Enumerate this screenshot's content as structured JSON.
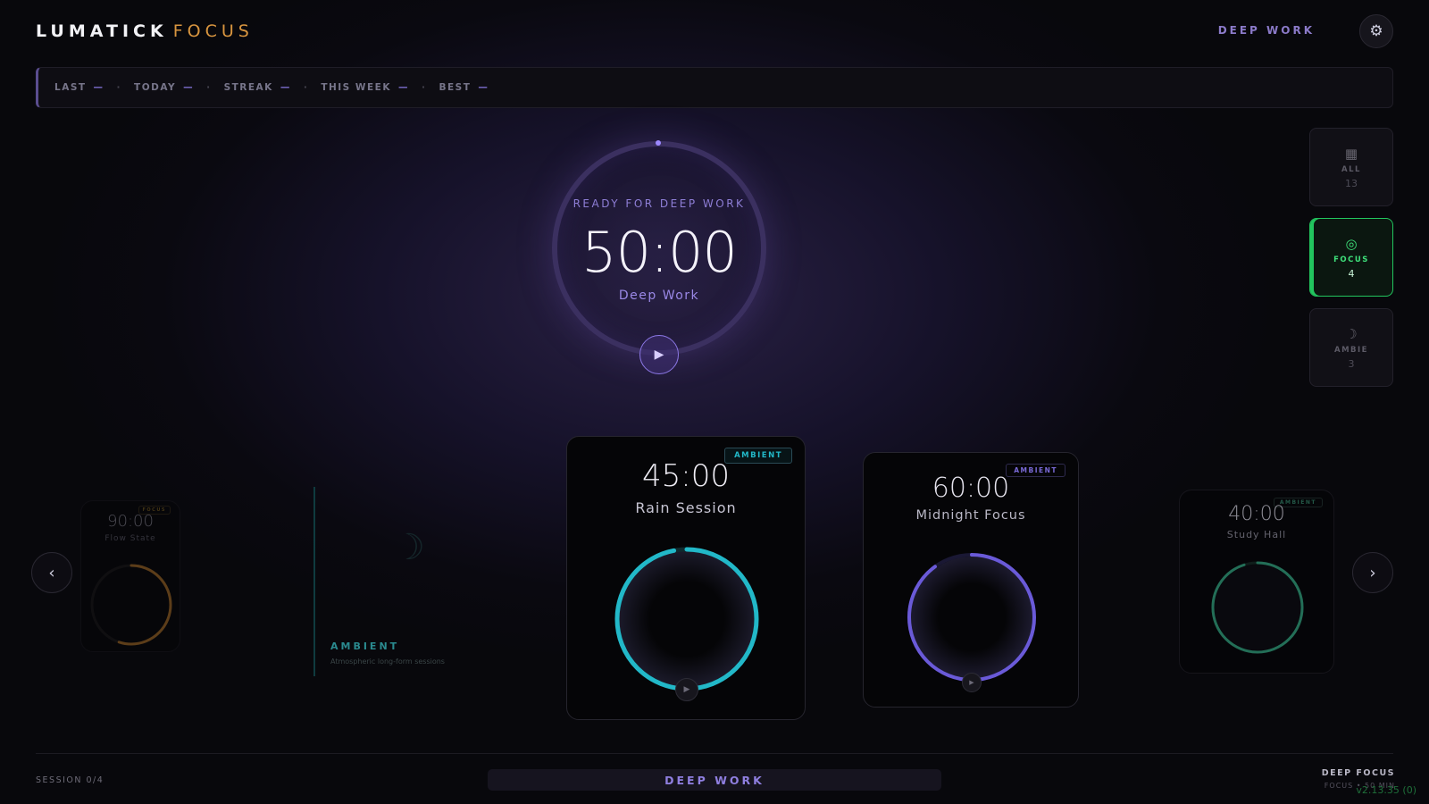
{
  "header": {
    "brand_primary": "LUMATICK",
    "brand_accent": "FOCUS",
    "mode_label": "DEEP WORK",
    "settings_icon": "gear-icon"
  },
  "stats": [
    {
      "label": "LAST",
      "value": "—"
    },
    {
      "label": "TODAY",
      "value": "—"
    },
    {
      "label": "STREAK",
      "value": "—"
    },
    {
      "label": "THIS WEEK",
      "value": "—"
    },
    {
      "label": "BEST",
      "value": "—"
    }
  ],
  "stats_separator": "·",
  "timer": {
    "status": "READY FOR DEEP WORK",
    "time": "50:00",
    "name": "Deep Work",
    "play_icon": "play-icon"
  },
  "filters": [
    {
      "label": "ALL",
      "count": "13",
      "icon": "grid-icon",
      "glyph": "▦"
    },
    {
      "label": "FOCUS",
      "count": "4",
      "icon": "target-icon",
      "glyph": "◎",
      "active": true
    },
    {
      "label": "AMBIE",
      "count": "3",
      "icon": "moon-icon",
      "glyph": "☽"
    }
  ],
  "carousel": {
    "prev_glyph": "‹",
    "next_glyph": "›",
    "cards": [
      {
        "time": "90:00",
        "title": "Flow State",
        "badge": "FOCUS",
        "color": "#c27d2a",
        "progress": 0.55
      },
      {
        "time": "45:00",
        "title": "Rain Session",
        "badge": "AMBIENT",
        "color": "#22b8c8",
        "progress": 0.97
      },
      {
        "time": "60:00",
        "title": "Midnight Focus",
        "badge": "AMBIENT",
        "color": "#6a5ad8",
        "progress": 0.9
      },
      {
        "time": "40:00",
        "title": "Study Hall",
        "badge": "AMBIENT",
        "color": "#2f9a78",
        "progress": 0.95
      }
    ],
    "category": {
      "title": "AMBIENT",
      "subtitle": "Atmospheric long-form sessions"
    }
  },
  "footer": {
    "session": "SESSION 0/4",
    "mode": "DEEP WORK",
    "right_title": "DEEP FOCUS",
    "right_sub": "FOCUS • 50 MIN",
    "version": "v2.13.35 (0)"
  },
  "colors": {
    "accent": "#8c78e6",
    "brand_accent": "#d8953f",
    "focus_active": "#22c55e"
  }
}
